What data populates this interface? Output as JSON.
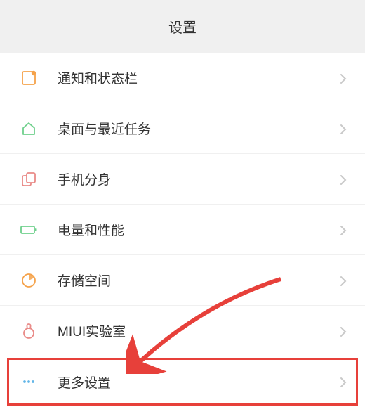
{
  "header": {
    "title": "设置"
  },
  "items": [
    {
      "label": "通知和状态栏",
      "icon": "notification"
    },
    {
      "label": "桌面与最近任务",
      "icon": "home"
    },
    {
      "label": "手机分身",
      "icon": "dual-apps"
    },
    {
      "label": "电量和性能",
      "icon": "battery"
    },
    {
      "label": "存储空间",
      "icon": "storage"
    },
    {
      "label": "MIUI实验室",
      "icon": "lab"
    },
    {
      "label": "更多设置",
      "icon": "more",
      "highlighted": true
    }
  ],
  "colors": {
    "accent_highlight": "#e7403a",
    "icon_blue": "#62b6e8",
    "icon_green": "#6fd08c",
    "icon_orange": "#f5a24a",
    "icon_red": "#e98b88"
  }
}
